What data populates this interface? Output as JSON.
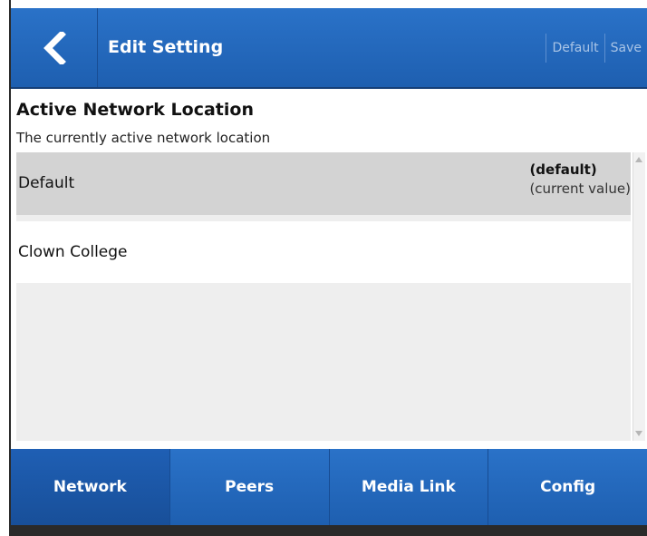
{
  "header": {
    "title": "Edit Setting",
    "actions": [
      "Default",
      "Save"
    ]
  },
  "setting": {
    "title": "Active Network Location",
    "description": "The currently active network location"
  },
  "options": [
    {
      "label": "Default",
      "tag": "(default)",
      "status": "(current value)",
      "selected": true
    },
    {
      "label": "Clown College",
      "selected": false
    }
  ],
  "tabs": [
    "Network",
    "Peers",
    "Media Link",
    "Config"
  ],
  "active_tab": "Network",
  "colors": {
    "accent": "#2268bd",
    "selected_row": "#d3d3d3",
    "list_bg": "#eeeeee"
  },
  "icons": {
    "back": "chevron-left-icon"
  }
}
